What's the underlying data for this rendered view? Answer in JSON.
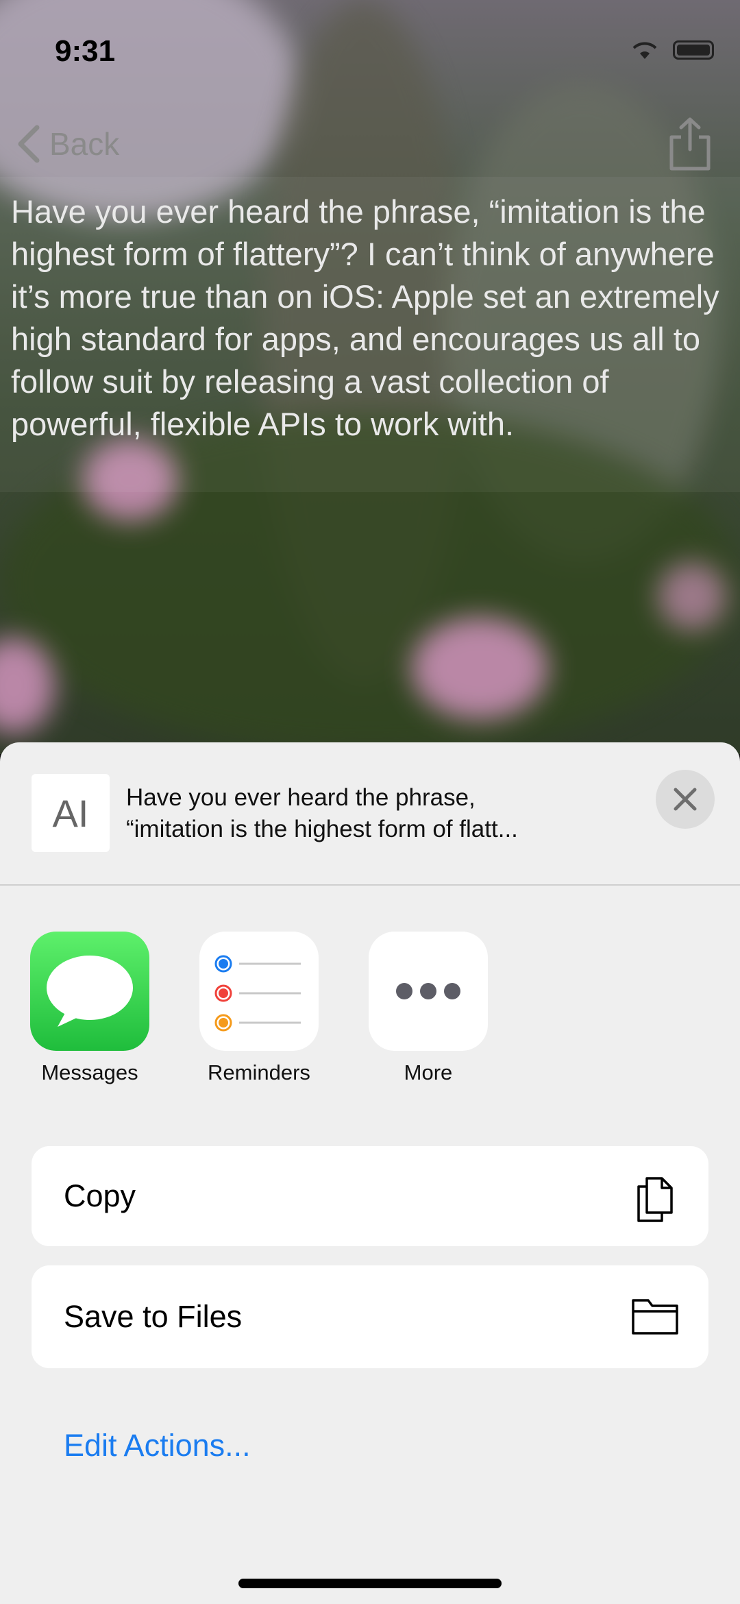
{
  "status_bar": {
    "time": "9:31"
  },
  "nav": {
    "back_label": "Back"
  },
  "article": {
    "text": "Have you ever heard the phrase, “imitation is the highest form of flattery”? I can’t think of anywhere it’s more true than on iOS: Apple set an extremely high standard for apps, and encourages us all to follow suit by releasing a vast collection of powerful, flexible APIs to work with."
  },
  "share_sheet": {
    "preview": {
      "thumb_glyph": "AI",
      "line1": "Have you ever heard the phrase,",
      "line2": "“imitation is the highest form of flatt..."
    },
    "apps": [
      {
        "label": "Messages",
        "icon": "messages-icon",
        "color": "#2fc845"
      },
      {
        "label": "Reminders",
        "icon": "reminders-icon",
        "color": "#ffffff"
      },
      {
        "label": "More",
        "icon": "more-icon",
        "color": "#ffffff"
      }
    ],
    "actions": [
      {
        "label": "Copy",
        "icon": "copy-icon"
      },
      {
        "label": "Save to Files",
        "icon": "folder-icon"
      }
    ],
    "edit_actions_label": "Edit Actions..."
  },
  "colors": {
    "accent": "#1a7cf0",
    "messages_green": "#2fc845"
  }
}
